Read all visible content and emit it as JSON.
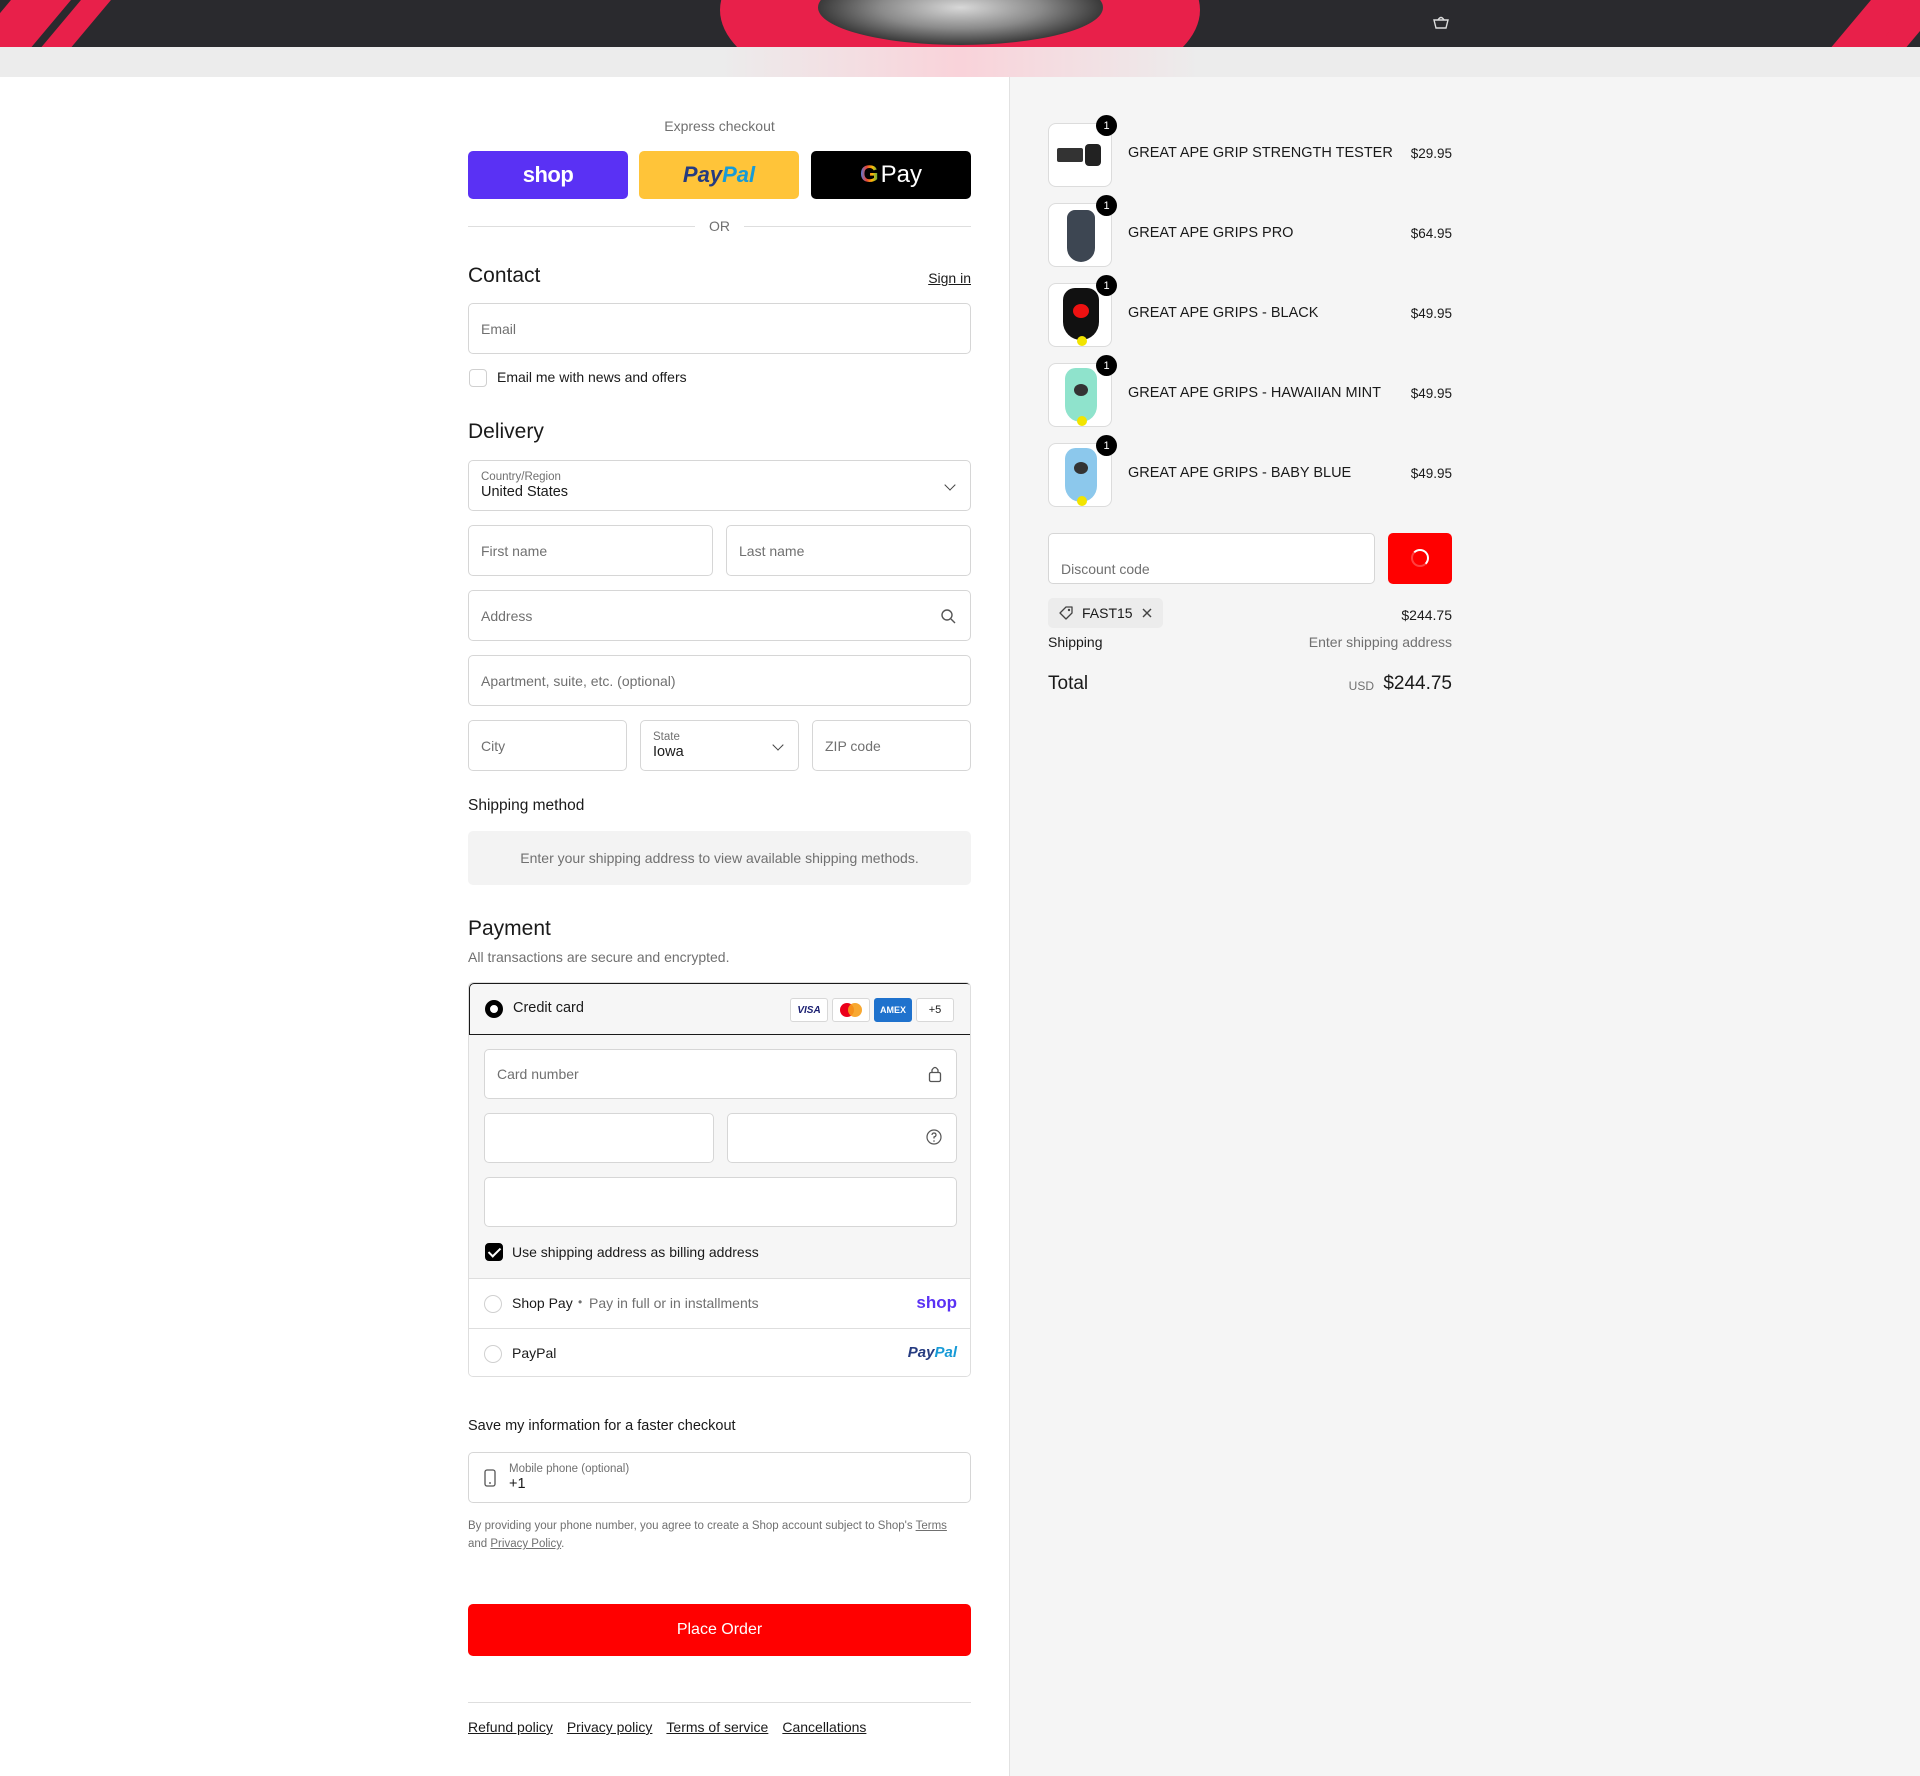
{
  "express": {
    "title": "Express checkout",
    "shop_label": "shop",
    "paypal_label_1": "Pay",
    "paypal_label_2": "Pal",
    "gpay_g": "G",
    "gpay_label": "Pay",
    "or": "OR"
  },
  "contact": {
    "title": "Contact",
    "sign_in": "Sign in",
    "email_placeholder": "Email",
    "newsletter_label": "Email me with news and offers",
    "newsletter_checked": false
  },
  "delivery": {
    "title": "Delivery",
    "country_label": "Country/Region",
    "country_value": "United States",
    "first_name": "First name",
    "last_name": "Last name",
    "address": "Address",
    "apartment": "Apartment, suite, etc. (optional)",
    "city": "City",
    "state_label": "State",
    "state_value": "Iowa",
    "zip": "ZIP code"
  },
  "shipping_method": {
    "title": "Shipping method",
    "message": "Enter your shipping address to view available shipping methods."
  },
  "payment": {
    "title": "Payment",
    "subtitle": "All transactions are secure and encrypted.",
    "credit_card_label": "Credit card",
    "card_badges": [
      "VISA",
      "",
      "AMEX",
      "+5"
    ],
    "card_number_placeholder": "Card number",
    "billing_same_label": "Use shipping address as billing address",
    "billing_same_checked": true,
    "shop_pay_label": "Shop Pay",
    "shop_pay_sep": "•",
    "shop_pay_desc": "Pay in full or in installments",
    "shop_pay_logo": "shop",
    "paypal_label": "PayPal",
    "paypal_logo_1": "Pay",
    "paypal_logo_2": "Pal"
  },
  "save_info": {
    "title": "Save my information for a faster checkout",
    "phone_label": "Mobile phone (optional)",
    "phone_value": "+1",
    "legal_1": "By providing your phone number, you agree to create a Shop account subject to Shop's",
    "legal_terms": "Terms",
    "legal_and": "and",
    "legal_privacy": "Privacy Policy",
    "legal_end": "."
  },
  "place_order": "Place Order",
  "footer_links": [
    "Refund policy",
    "Privacy policy",
    "Terms of service",
    "Cancellations"
  ],
  "cart": {
    "items": [
      {
        "name": "GREAT APE GRIP STRENGTH TESTER",
        "price": "$29.95",
        "qty": "1",
        "color": "#333"
      },
      {
        "name": "GREAT APE GRIPS PRO",
        "price": "$64.95",
        "qty": "1",
        "color": "#3d4652"
      },
      {
        "name": "GREAT APE GRIPS - BLACK",
        "price": "$49.95",
        "qty": "1",
        "color": "#111111"
      },
      {
        "name": "GREAT APE GRIPS - HAWAIIAN MINT",
        "price": "$49.95",
        "qty": "1",
        "color": "#8fe3cc"
      },
      {
        "name": "GREAT APE GRIPS - BABY BLUE",
        "price": "$49.95",
        "qty": "1",
        "color": "#8cc8ec"
      }
    ],
    "discount_placeholder": "Discount code",
    "applied_code": "FAST15",
    "subtotal": "$244.75",
    "shipping_label": "Shipping",
    "shipping_value": "Enter shipping address",
    "total_label": "Total",
    "currency": "USD",
    "total": "$244.75"
  },
  "colors": {
    "accent_red": "#ff0000",
    "shop_purple": "#5a31f4",
    "paypal_yellow": "#ffc439",
    "banner_red": "#e8204a"
  }
}
